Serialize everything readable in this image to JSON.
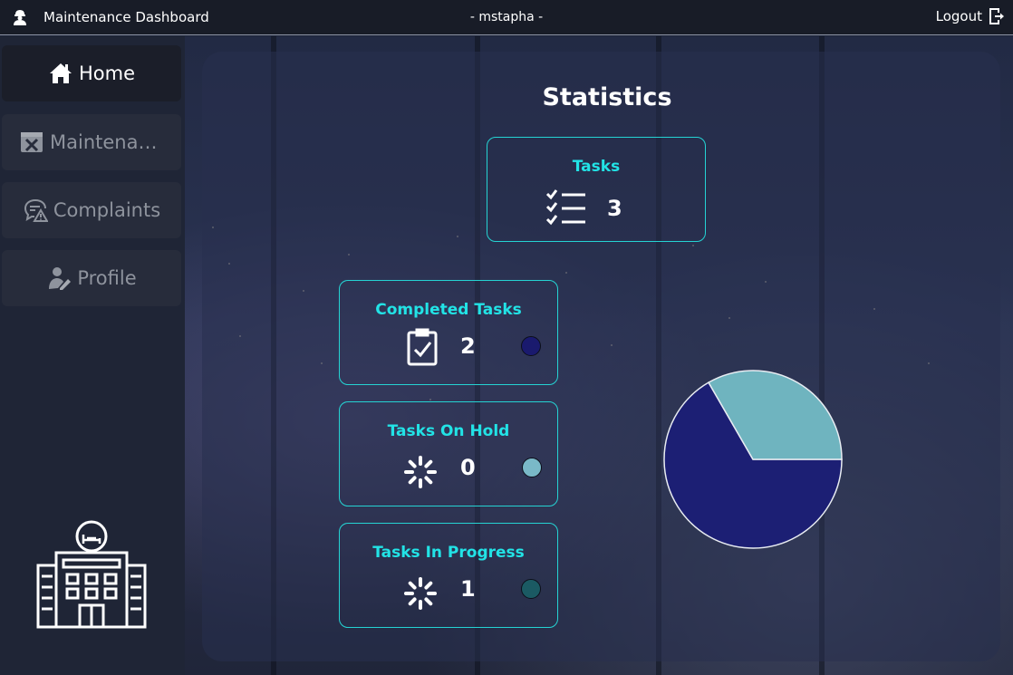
{
  "topbar": {
    "app_title": "Maintenance Dashboard",
    "user_label": "- mstapha -",
    "logout_label": "Logout"
  },
  "sidebar": {
    "items": [
      {
        "label": "Home",
        "icon": "home-icon",
        "active": true
      },
      {
        "label": "Maintenance",
        "icon": "maintenance-icon",
        "active": false
      },
      {
        "label": "Complaints",
        "icon": "complaints-icon",
        "active": false
      },
      {
        "label": "Profile",
        "icon": "profile-icon",
        "active": false
      }
    ]
  },
  "stats": {
    "title": "Statistics",
    "total": {
      "label": "Tasks",
      "value": "3",
      "icon": "checklist-icon"
    },
    "completed": {
      "label": "Completed Tasks",
      "value": "2",
      "icon": "clipboard-check-icon",
      "color": "#1a1a6e"
    },
    "on_hold": {
      "label": "Tasks On Hold",
      "value": "0",
      "icon": "spinner-icon",
      "color": "#7ab9c8"
    },
    "in_progress": {
      "label": "Tasks In Progress",
      "value": "1",
      "icon": "spinner-icon",
      "color": "#1b5a63"
    }
  },
  "chart_data": {
    "type": "pie",
    "slices": [
      {
        "label": "Completed Tasks",
        "value": 2,
        "color": "#1c1f74"
      },
      {
        "label": "Tasks On Hold",
        "value": 0,
        "color": "#7ab9c8"
      },
      {
        "label": "Tasks In Progress",
        "value": 1,
        "color": "#6fb4bf"
      }
    ]
  },
  "colors": {
    "accent": "#22e3e6",
    "card_border": "#25d3d3"
  }
}
